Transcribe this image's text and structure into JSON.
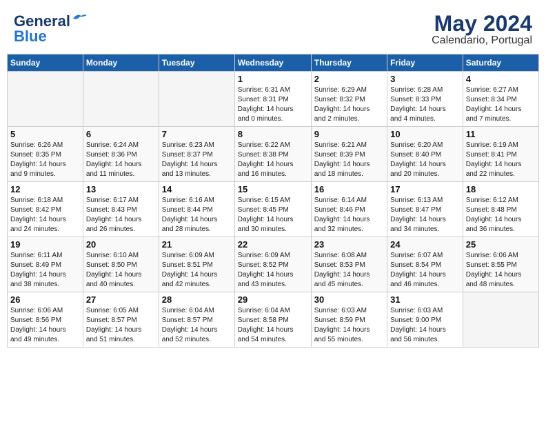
{
  "header": {
    "logo_general": "General",
    "logo_blue": "Blue",
    "month": "May 2024",
    "location": "Calendario, Portugal"
  },
  "days_of_week": [
    "Sunday",
    "Monday",
    "Tuesday",
    "Wednesday",
    "Thursday",
    "Friday",
    "Saturday"
  ],
  "weeks": [
    [
      {
        "day": "",
        "info": ""
      },
      {
        "day": "",
        "info": ""
      },
      {
        "day": "",
        "info": ""
      },
      {
        "day": "1",
        "info": "Sunrise: 6:31 AM\nSunset: 8:31 PM\nDaylight: 14 hours\nand 0 minutes."
      },
      {
        "day": "2",
        "info": "Sunrise: 6:29 AM\nSunset: 8:32 PM\nDaylight: 14 hours\nand 2 minutes."
      },
      {
        "day": "3",
        "info": "Sunrise: 6:28 AM\nSunset: 8:33 PM\nDaylight: 14 hours\nand 4 minutes."
      },
      {
        "day": "4",
        "info": "Sunrise: 6:27 AM\nSunset: 8:34 PM\nDaylight: 14 hours\nand 7 minutes."
      }
    ],
    [
      {
        "day": "5",
        "info": "Sunrise: 6:26 AM\nSunset: 8:35 PM\nDaylight: 14 hours\nand 9 minutes."
      },
      {
        "day": "6",
        "info": "Sunrise: 6:24 AM\nSunset: 8:36 PM\nDaylight: 14 hours\nand 11 minutes."
      },
      {
        "day": "7",
        "info": "Sunrise: 6:23 AM\nSunset: 8:37 PM\nDaylight: 14 hours\nand 13 minutes."
      },
      {
        "day": "8",
        "info": "Sunrise: 6:22 AM\nSunset: 8:38 PM\nDaylight: 14 hours\nand 16 minutes."
      },
      {
        "day": "9",
        "info": "Sunrise: 6:21 AM\nSunset: 8:39 PM\nDaylight: 14 hours\nand 18 minutes."
      },
      {
        "day": "10",
        "info": "Sunrise: 6:20 AM\nSunset: 8:40 PM\nDaylight: 14 hours\nand 20 minutes."
      },
      {
        "day": "11",
        "info": "Sunrise: 6:19 AM\nSunset: 8:41 PM\nDaylight: 14 hours\nand 22 minutes."
      }
    ],
    [
      {
        "day": "12",
        "info": "Sunrise: 6:18 AM\nSunset: 8:42 PM\nDaylight: 14 hours\nand 24 minutes."
      },
      {
        "day": "13",
        "info": "Sunrise: 6:17 AM\nSunset: 8:43 PM\nDaylight: 14 hours\nand 26 minutes."
      },
      {
        "day": "14",
        "info": "Sunrise: 6:16 AM\nSunset: 8:44 PM\nDaylight: 14 hours\nand 28 minutes."
      },
      {
        "day": "15",
        "info": "Sunrise: 6:15 AM\nSunset: 8:45 PM\nDaylight: 14 hours\nand 30 minutes."
      },
      {
        "day": "16",
        "info": "Sunrise: 6:14 AM\nSunset: 8:46 PM\nDaylight: 14 hours\nand 32 minutes."
      },
      {
        "day": "17",
        "info": "Sunrise: 6:13 AM\nSunset: 8:47 PM\nDaylight: 14 hours\nand 34 minutes."
      },
      {
        "day": "18",
        "info": "Sunrise: 6:12 AM\nSunset: 8:48 PM\nDaylight: 14 hours\nand 36 minutes."
      }
    ],
    [
      {
        "day": "19",
        "info": "Sunrise: 6:11 AM\nSunset: 8:49 PM\nDaylight: 14 hours\nand 38 minutes."
      },
      {
        "day": "20",
        "info": "Sunrise: 6:10 AM\nSunset: 8:50 PM\nDaylight: 14 hours\nand 40 minutes."
      },
      {
        "day": "21",
        "info": "Sunrise: 6:09 AM\nSunset: 8:51 PM\nDaylight: 14 hours\nand 42 minutes."
      },
      {
        "day": "22",
        "info": "Sunrise: 6:09 AM\nSunset: 8:52 PM\nDaylight: 14 hours\nand 43 minutes."
      },
      {
        "day": "23",
        "info": "Sunrise: 6:08 AM\nSunset: 8:53 PM\nDaylight: 14 hours\nand 45 minutes."
      },
      {
        "day": "24",
        "info": "Sunrise: 6:07 AM\nSunset: 8:54 PM\nDaylight: 14 hours\nand 46 minutes."
      },
      {
        "day": "25",
        "info": "Sunrise: 6:06 AM\nSunset: 8:55 PM\nDaylight: 14 hours\nand 48 minutes."
      }
    ],
    [
      {
        "day": "26",
        "info": "Sunrise: 6:06 AM\nSunset: 8:56 PM\nDaylight: 14 hours\nand 49 minutes."
      },
      {
        "day": "27",
        "info": "Sunrise: 6:05 AM\nSunset: 8:57 PM\nDaylight: 14 hours\nand 51 minutes."
      },
      {
        "day": "28",
        "info": "Sunrise: 6:04 AM\nSunset: 8:57 PM\nDaylight: 14 hours\nand 52 minutes."
      },
      {
        "day": "29",
        "info": "Sunrise: 6:04 AM\nSunset: 8:58 PM\nDaylight: 14 hours\nand 54 minutes."
      },
      {
        "day": "30",
        "info": "Sunrise: 6:03 AM\nSunset: 8:59 PM\nDaylight: 14 hours\nand 55 minutes."
      },
      {
        "day": "31",
        "info": "Sunrise: 6:03 AM\nSunset: 9:00 PM\nDaylight: 14 hours\nand 56 minutes."
      },
      {
        "day": "",
        "info": ""
      }
    ]
  ]
}
